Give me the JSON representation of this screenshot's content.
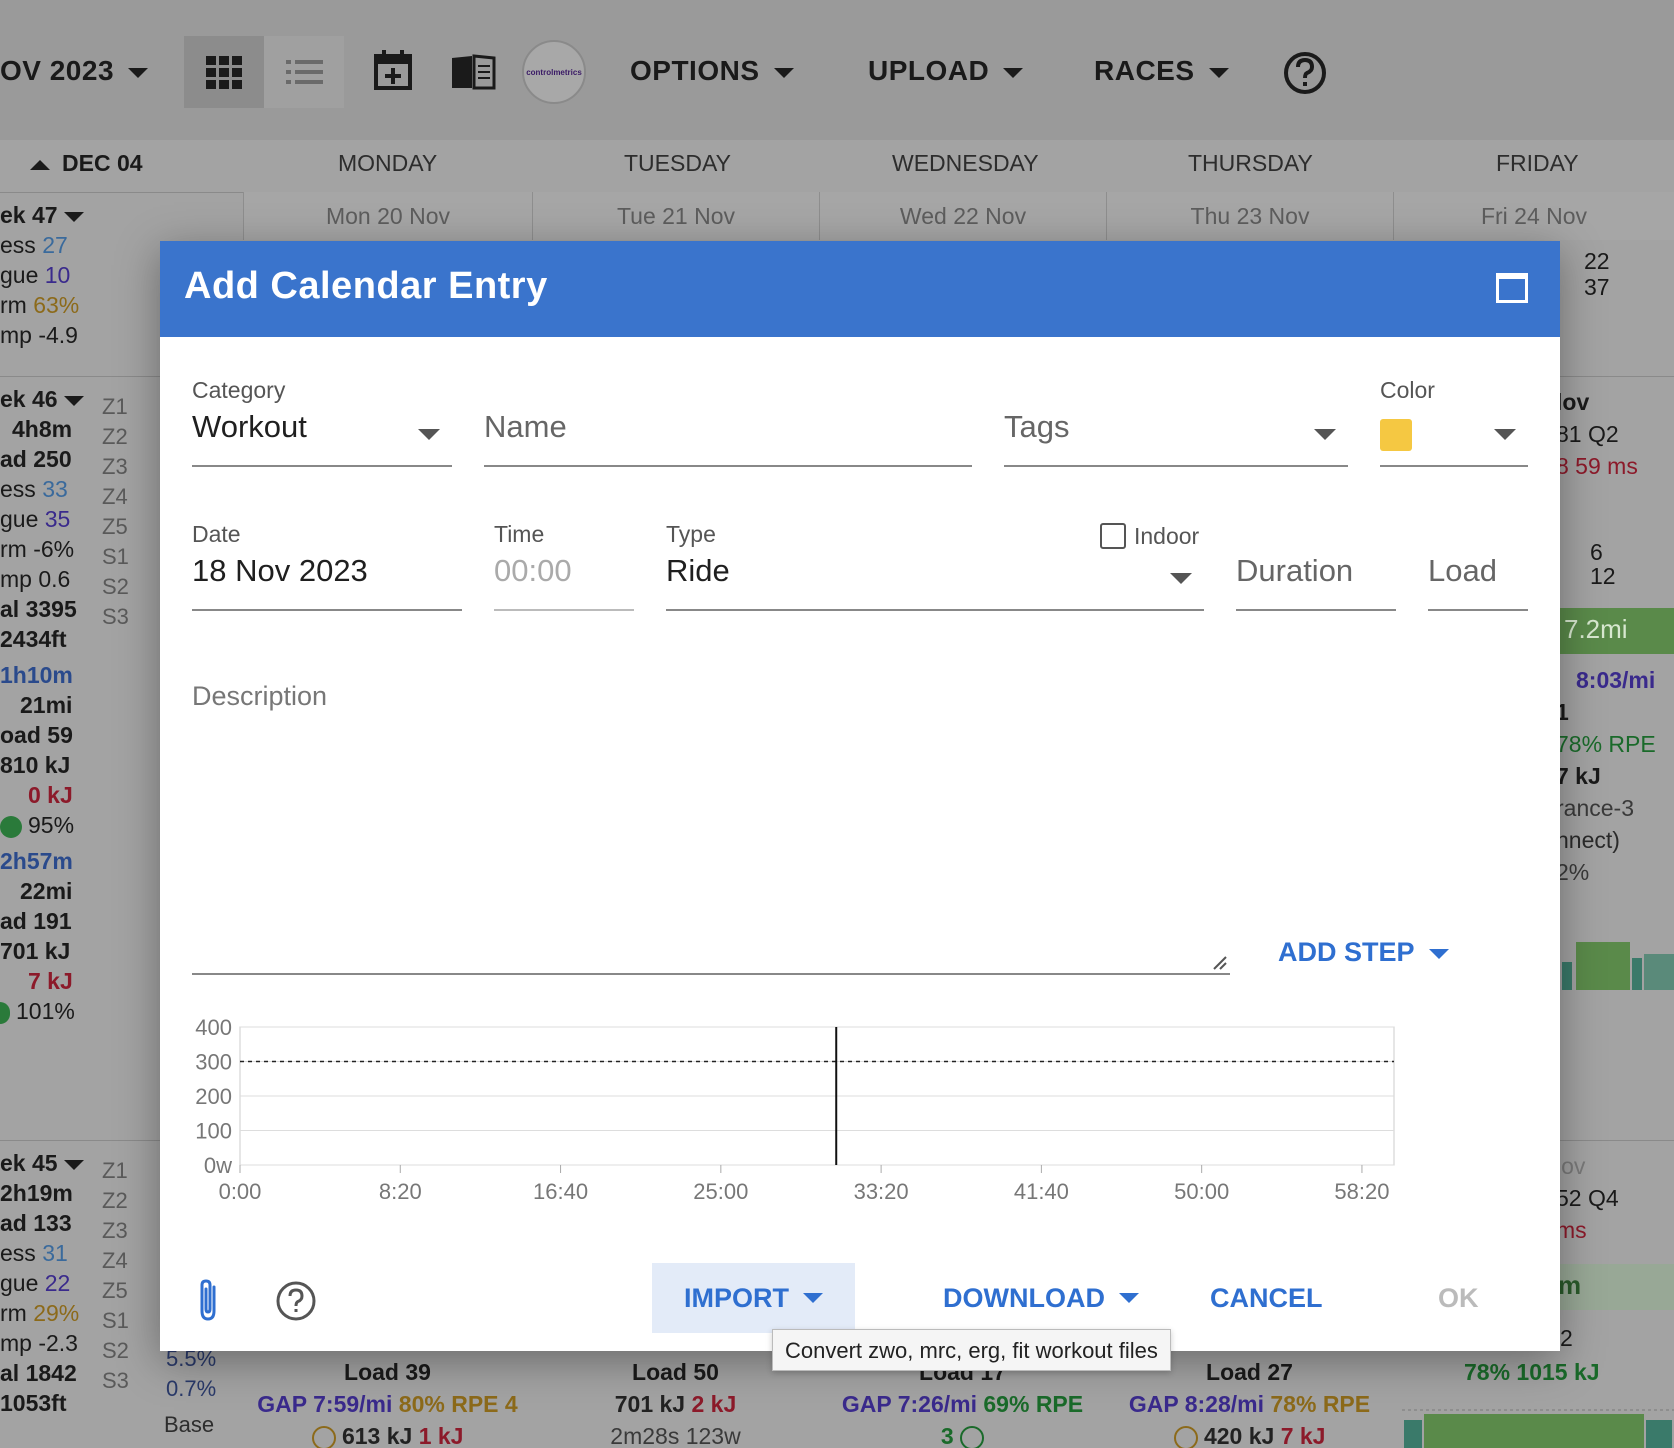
{
  "toolbar": {
    "month_label": "OV 2023",
    "options_label": "OPTIONS",
    "upload_label": "UPLOAD",
    "races_label": "RACES",
    "logo_text": "controlmetrics"
  },
  "calendar": {
    "week_toggle": "DEC 04",
    "days": [
      "MONDAY",
      "TUESDAY",
      "WEDNESDAY",
      "THURSDAY",
      "FRIDAY"
    ],
    "dates": [
      "Mon 20 Nov",
      "Tue 21 Nov",
      "Wed 22 Nov",
      "Thu 23 Nov",
      "Fri 24 Nov"
    ],
    "week47": {
      "label": "ek 47",
      "fitness": "ess ",
      "fitness_v": "27",
      "fatigue": "gue ",
      "fatigue_v": "10",
      "form": "rm ",
      "form_v": "63%",
      "ramp": "mp -4.9"
    },
    "week46": {
      "label": "ek 46",
      "time": "4h8m",
      "load": "ad 250",
      "fitness": "ess ",
      "fitness_v": "33",
      "fatigue": "gue ",
      "fatigue_v": "35",
      "form": "rm -6%",
      "ramp": "mp 0.6",
      "total": "al 3395",
      "elev": "2434ft",
      "t1": "1h10m",
      "d1": "21mi",
      "l1": "oad 59",
      "k1": "810 kJ",
      "k1b": "0 kJ",
      "p1": "95%",
      "t2": "2h57m",
      "d2": "22mi",
      "l2": "ad 191",
      "k2": "701 kJ",
      "k2b": "7 kJ",
      "p2": "101%"
    },
    "week45": {
      "label": "ek 45",
      "time": "2h19m",
      "load": "ad 133",
      "fitness": "ess ",
      "fitness_v": "31",
      "fatigue": "gue ",
      "fatigue_v": "22",
      "form": "rm ",
      "form_v": "29%",
      "ramp": "mp -2.3",
      "total": "al 1842",
      "elev": "1053ft"
    },
    "zones": [
      "Z1",
      "Z2",
      "Z3",
      "Z4",
      "Z5",
      "S1",
      "S2",
      "S3"
    ],
    "zone_vals_45": [
      "5.5%",
      "0.7%",
      "Base"
    ],
    "right": {
      "top1": "22",
      "top2": "37",
      "nov": "lov",
      "q2": "81 Q2",
      "ms": "8 59 ms",
      "n6": "6",
      "n12": "12",
      "green": "7.2mi",
      "pace": "8:03/mi",
      "n1": "1",
      "rpe": "78% RPE",
      "kj": "7 kJ",
      "rance": "rance-3",
      "nnect": "nnect)",
      "pct": "2%",
      "nov2": "lov",
      "q4": "52 Q4",
      "ms2": "ms",
      "m": "m",
      "n2": "2",
      "kj2": "78% 1015 kJ"
    },
    "bottom": [
      {
        "load": "Load 39",
        "gap": "GAP 7:59/mi",
        "pct": "80%",
        "rpe": "RPE 4",
        "kj": "613 kJ",
        "kj2": "1 kJ"
      },
      {
        "load": "Load 50",
        "gap": "701 kJ",
        "pct": "2 kJ",
        "rpe": "",
        "kj": "2m28s 123w",
        "kj2": ""
      },
      {
        "load": "Load 17",
        "gap": "GAP 7:26/mi",
        "pct": "69%",
        "rpe": "RPE",
        "kj": "3",
        "kj2": ""
      },
      {
        "load": "Load 27",
        "gap": "GAP 8:28/mi",
        "pct": "78%",
        "rpe": "RPE",
        "kj": "420 kJ",
        "kj2": "7 kJ"
      }
    ]
  },
  "dialog": {
    "title": "Add Calendar Entry",
    "category_label": "Category",
    "category_value": "Workout",
    "name_placeholder": "Name",
    "tags_placeholder": "Tags",
    "color_label": "Color",
    "color_value": "#f5c842",
    "date_label": "Date",
    "date_value": "18 Nov 2023",
    "time_label": "Time",
    "time_value": "00:00",
    "type_label": "Type",
    "type_value": "Ride",
    "indoor_label": "Indoor",
    "indoor_checked": false,
    "duration_placeholder": "Duration",
    "load_placeholder": "Load",
    "description_placeholder": "Description",
    "add_step_label": "ADD STEP",
    "import_label": "IMPORT",
    "download_label": "DOWNLOAD",
    "cancel_label": "CANCEL",
    "ok_label": "OK",
    "tooltip": "Convert zwo, mrc, erg, fit workout files"
  },
  "chart_data": {
    "type": "line",
    "x_ticks": [
      "0:00",
      "8:20",
      "16:40",
      "25:00",
      "33:20",
      "41:40",
      "50:00",
      "58:20"
    ],
    "y_ticks": [
      "400",
      "300",
      "200",
      "100",
      "0w"
    ],
    "ylim": [
      0,
      400
    ],
    "reference_line": 300,
    "cursor_x": "31:00",
    "series": []
  },
  "colors": {
    "header_blue": "#3a74cc",
    "accent_blue": "#2f6fd0"
  }
}
